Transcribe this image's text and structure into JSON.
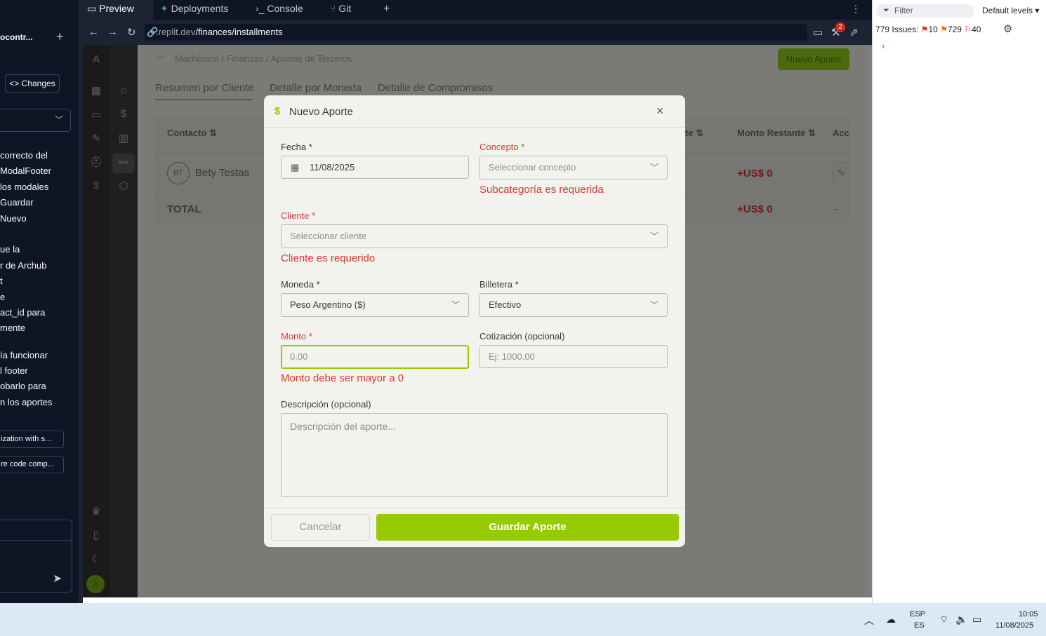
{
  "left_panel": {
    "title": "ocontr...",
    "changes_label": "<> Changes",
    "lines": [
      "correcto del",
      "ModalFooter",
      "los modales",
      "Guardar",
      "Nuevo",
      "",
      "ue la",
      "r de Archub",
      "t",
      "e",
      "act_id para",
      "mente",
      "",
      "ía funcionar",
      "l footer",
      "obarlo para",
      "n los aportes"
    ],
    "pills": [
      "ization with s...",
      "re code comp..."
    ]
  },
  "browser": {
    "tabs": [
      {
        "icon": "monitor-icon",
        "label": "Preview"
      },
      {
        "icon": "deploy-icon",
        "label": "Deployments"
      },
      {
        "icon": "terminal-icon",
        "label": "Console"
      },
      {
        "icon": "git-icon",
        "label": "Git"
      }
    ],
    "new_tab": "+",
    "more": "⋮",
    "url_host": ".replit.dev",
    "url_path": "/finances/installments",
    "badge_count": "2"
  },
  "app": {
    "logo": "A",
    "breadcrumb": "Machónico / Finanzas / Aportes de Terceros",
    "new_button": "Nuevo Aporte",
    "tabs": [
      "Resumen por Cliente",
      "Detalle por Moneda",
      "Detalle de Compromisos"
    ],
    "table": {
      "headers": [
        "Contacto ⇅",
        "te ⇅",
        "Monto Restante ⇅",
        "Acc"
      ],
      "row": {
        "avatar": "BT",
        "name": "Bety Testas",
        "remaining": "+US$ 0"
      },
      "total": {
        "label": "TOTAL",
        "remaining": "+US$ 0",
        "action": "-"
      }
    },
    "user_avatar": "A"
  },
  "modal": {
    "title": "Nuevo Aporte",
    "close": "×",
    "fecha": {
      "label": "Fecha *",
      "value": "11/08/2025"
    },
    "concepto": {
      "label": "Concepto *",
      "placeholder": "Seleccionar concepto",
      "error": "Subcategoría es requerida"
    },
    "cliente": {
      "label": "Cliente *",
      "placeholder": "Seleccionar cliente",
      "error": "Cliente es requerido"
    },
    "moneda": {
      "label": "Moneda *",
      "value": "Peso Argentino ($)"
    },
    "billetera": {
      "label": "Billetera *",
      "value": "Efectivo"
    },
    "monto": {
      "label": "Monto *",
      "placeholder": "0.00",
      "error": "Monto debe ser mayor a 0"
    },
    "cotizacion": {
      "label": "Cotización (opcional)",
      "placeholder": "Ej: 1000.00"
    },
    "descripcion": {
      "label": "Descripción (opcional)",
      "placeholder": "Descripción del aporte..."
    },
    "cancel": "Cancelar",
    "save": "Guardar Aporte"
  },
  "devtools": {
    "filter_placeholder": "Filter",
    "levels": "Default levels ▾",
    "issues_label": "779 Issues:",
    "errors": "10",
    "warnings": "729",
    "infos": "40"
  },
  "taskbar": {
    "lang_top": "ESP",
    "lang_bottom": "ES",
    "time": "10:05",
    "date": "11/08/2025"
  },
  "colors": {
    "accent": "#97cb00",
    "error": "#d83a34",
    "sidebar_bg": "#0e1525"
  }
}
